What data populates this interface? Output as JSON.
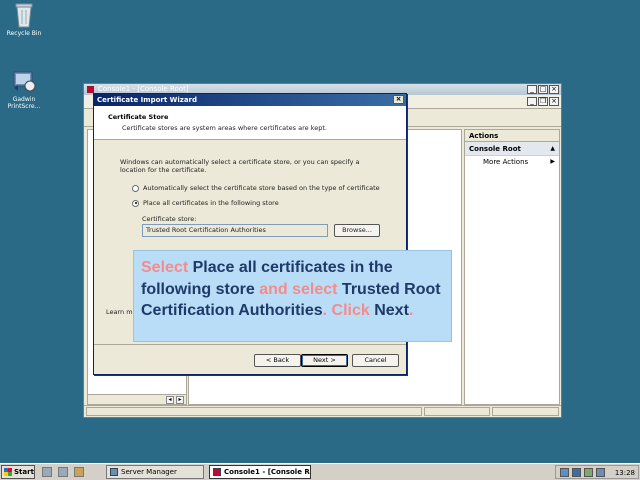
{
  "desktop": {
    "icons": [
      {
        "label": "Recycle Bin"
      },
      {
        "label_line1": "Gadwin",
        "label_line2": "PrintScre..."
      }
    ]
  },
  "console": {
    "title": "Console1 - [Console Root]",
    "actions": {
      "header": "Actions",
      "section": "Console Root",
      "items": [
        "More Actions"
      ]
    }
  },
  "wizard": {
    "title": "Certificate Import Wizard",
    "heading": "Certificate Store",
    "subheading": "Certificate stores are system areas where certificates are kept.",
    "intro": "Windows can automatically select a certificate store, or you can specify a location for the certificate.",
    "options": {
      "auto": "Automatically select the certificate store based on the type of certificate",
      "place": "Place all certificates in the following store"
    },
    "store_label": "Certificate store:",
    "store_value": "Trusted Root Certification Authorities",
    "browse": "Browse...",
    "learn_more": "Learn mo",
    "back": "< Back",
    "next": "Next >",
    "cancel": "Cancel"
  },
  "callout": {
    "p1": "Select",
    "p2": " Place all certificates in the following store ",
    "p3": "and select",
    "p4": " Trusted Root Certification Authorities",
    "p5": ". Click",
    "p6": " Next",
    "p7": "."
  },
  "taskbar": {
    "start": "Start",
    "tasks": [
      "Server Manager",
      "Console1 - [Console R..."
    ],
    "clock": "13:28"
  }
}
